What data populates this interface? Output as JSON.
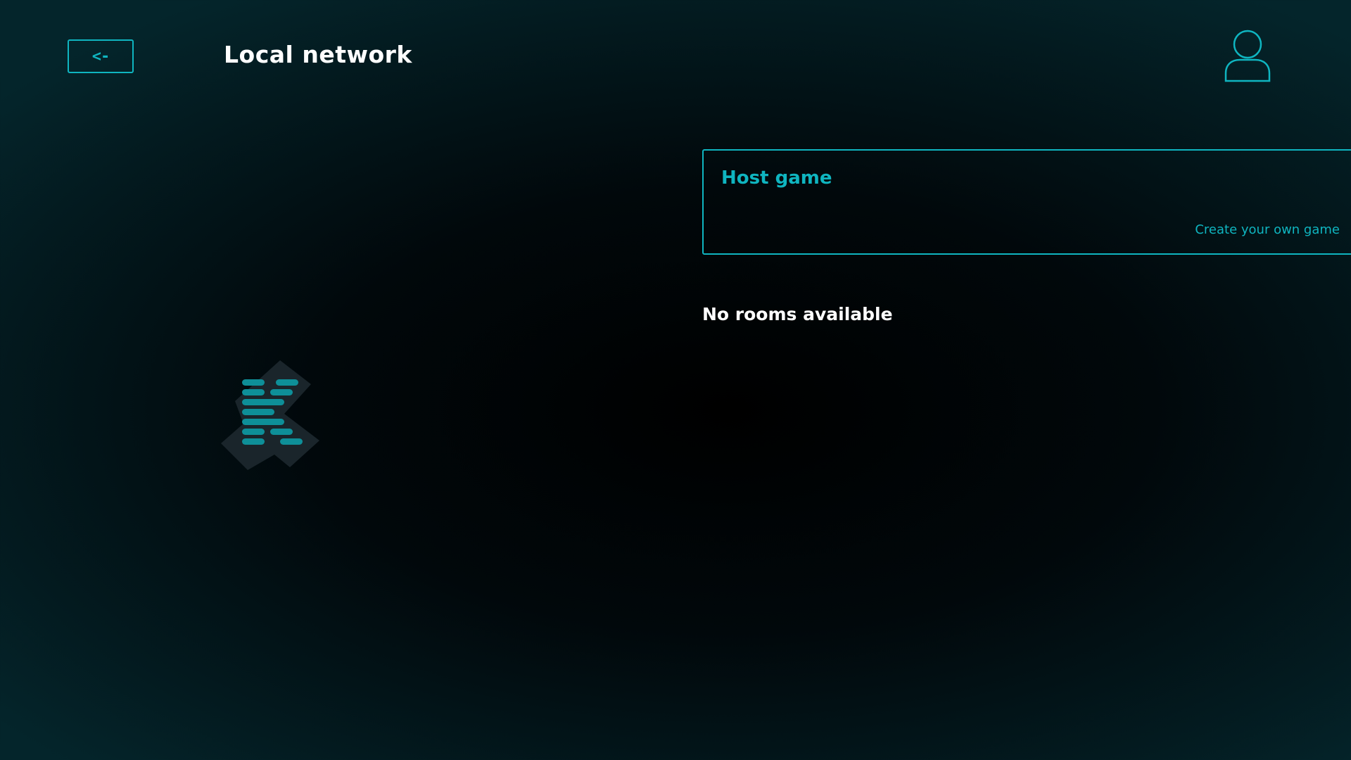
{
  "header": {
    "back_label": "<-",
    "title": "Local network",
    "user_icon": "user-profile-icon"
  },
  "host_card": {
    "title": "Host game",
    "subtitle": "Create your own game"
  },
  "rooms": {
    "empty_text": "No rooms available"
  },
  "logo": {
    "icon": "app-logo"
  },
  "colors": {
    "accent": "#0fb5c0",
    "text": "#ffffff",
    "background": "#031a1f",
    "logo_bg": "#1a252b",
    "logo_bars": "#0e8f98"
  }
}
